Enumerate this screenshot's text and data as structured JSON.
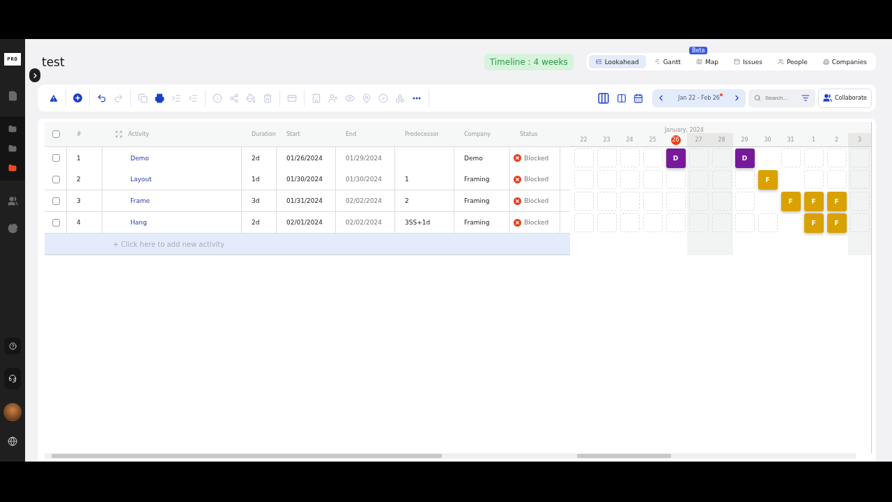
{
  "sidebar": {
    "logo": "PRO",
    "items": [
      {
        "kind": "file",
        "selected": false
      },
      {
        "kind": "folder",
        "selected": false
      },
      {
        "kind": "folder",
        "selected": false
      },
      {
        "kind": "folder",
        "selected": true
      },
      {
        "kind": "people",
        "selected": false
      },
      {
        "kind": "chart",
        "selected": false
      }
    ],
    "bottom": [
      {
        "kind": "help"
      },
      {
        "kind": "headset"
      },
      {
        "kind": "avatar"
      },
      {
        "kind": "globe"
      }
    ]
  },
  "page": {
    "title": "test",
    "timeline": "Timeline : 4 weeks"
  },
  "nav_tabs": [
    {
      "label": "Lookahead",
      "kind": "lookahead",
      "selected": true
    },
    {
      "label": "Gantt",
      "kind": "gantt",
      "selected": false
    },
    {
      "label": "Map",
      "kind": "map",
      "selected": false,
      "badge": "Beta"
    },
    {
      "label": "Issues",
      "kind": "issues",
      "selected": false
    },
    {
      "label": "People",
      "kind": "people",
      "selected": false
    },
    {
      "label": "Companies",
      "kind": "companies",
      "selected": false
    }
  ],
  "toolbar": {
    "groups": [
      [
        {
          "kind": "warning",
          "disabled": false
        }
      ],
      [
        {
          "kind": "add",
          "disabled": false
        }
      ],
      [
        {
          "kind": "undo",
          "disabled": false
        },
        {
          "kind": "redo",
          "disabled": true
        }
      ],
      [
        {
          "kind": "copy",
          "disabled": true
        },
        {
          "kind": "print",
          "disabled": false
        },
        {
          "kind": "indent",
          "disabled": true
        },
        {
          "kind": "outdent",
          "disabled": true
        }
      ],
      [
        {
          "kind": "info",
          "disabled": true
        },
        {
          "kind": "share",
          "disabled": true
        },
        {
          "kind": "paint",
          "disabled": true
        },
        {
          "kind": "delete",
          "disabled": true
        }
      ],
      [
        {
          "kind": "card",
          "disabled": true
        }
      ],
      [
        {
          "kind": "building",
          "disabled": true
        },
        {
          "kind": "user-add",
          "disabled": true
        },
        {
          "kind": "eye",
          "disabled": true
        },
        {
          "kind": "pin",
          "disabled": true
        },
        {
          "kind": "check",
          "disabled": true
        },
        {
          "kind": "shapes",
          "disabled": true
        },
        {
          "kind": "more",
          "disabled": false
        }
      ]
    ],
    "views": [
      {
        "kind": "columns3"
      },
      {
        "kind": "columns2"
      },
      {
        "kind": "calendar"
      }
    ],
    "date_range": "Jan 22 - Feb 26",
    "search": {
      "placeholder": "Search..."
    },
    "collaborate": "Collaborate"
  },
  "table": {
    "select_all_checked": false,
    "columns": [
      "#",
      "Activity",
      "Duration",
      "Start",
      "End",
      "Predecessor",
      "Company",
      "Status"
    ],
    "rows": [
      {
        "checked": false,
        "cells": [
          "1",
          "Demo",
          "2d",
          "01/26/2024",
          "01/29/2024",
          "",
          "Demo",
          "Blocked"
        ]
      },
      {
        "checked": false,
        "cells": [
          "2",
          "Layout",
          "1d",
          "01/30/2024",
          "01/30/2024",
          "1",
          "Framing",
          "Blocked"
        ]
      },
      {
        "checked": false,
        "cells": [
          "3",
          "Frame",
          "3d",
          "01/31/2024",
          "02/02/2024",
          "2",
          "Framing",
          "Blocked"
        ]
      },
      {
        "checked": false,
        "cells": [
          "4",
          "Hang",
          "2d",
          "02/01/2024",
          "02/02/2024",
          "3SS+1d",
          "Framing",
          "Blocked"
        ]
      }
    ],
    "add_row": "+ Click here to add new activity"
  },
  "gantt": {
    "month": "January, 2024",
    "days": [
      {
        "label": "22",
        "weekend": false,
        "today": false
      },
      {
        "label": "23",
        "weekend": false,
        "today": false
      },
      {
        "label": "24",
        "weekend": false,
        "today": false
      },
      {
        "label": "25",
        "weekend": false,
        "today": false
      },
      {
        "label": "26",
        "weekend": false,
        "today": true
      },
      {
        "label": "27",
        "weekend": true,
        "today": false
      },
      {
        "label": "28",
        "weekend": true,
        "today": false
      },
      {
        "label": "29",
        "weekend": false,
        "today": false
      },
      {
        "label": "30",
        "weekend": false,
        "today": false
      },
      {
        "label": "31",
        "weekend": false,
        "today": false
      },
      {
        "label": "1",
        "weekend": false,
        "today": false
      },
      {
        "label": "2",
        "weekend": false,
        "today": false
      },
      {
        "label": "3",
        "weekend": true,
        "today": false
      }
    ],
    "rows": [
      {
        "cells": [
          {
            "kind": "empty"
          },
          {
            "kind": "empty"
          },
          {
            "kind": "empty"
          },
          {
            "kind": "empty"
          },
          {
            "kind": "bar",
            "letter": "D",
            "color": "#761a9a"
          },
          {
            "kind": "empty"
          },
          {
            "kind": "empty"
          },
          {
            "kind": "bar",
            "letter": "D",
            "color": "#761a9a"
          },
          {
            "kind": "blank"
          },
          {
            "kind": "empty"
          },
          {
            "kind": "empty"
          },
          {
            "kind": "empty"
          },
          {
            "kind": "empty"
          }
        ]
      },
      {
        "cells": [
          {
            "kind": "empty"
          },
          {
            "kind": "empty"
          },
          {
            "kind": "empty"
          },
          {
            "kind": "empty"
          },
          {
            "kind": "empty"
          },
          {
            "kind": "empty"
          },
          {
            "kind": "empty"
          },
          {
            "kind": "empty"
          },
          {
            "kind": "bar",
            "letter": "F",
            "color": "#d9a200"
          },
          {
            "kind": "blank"
          },
          {
            "kind": "empty"
          },
          {
            "kind": "empty"
          },
          {
            "kind": "empty"
          }
        ]
      },
      {
        "cells": [
          {
            "kind": "empty"
          },
          {
            "kind": "empty"
          },
          {
            "kind": "empty"
          },
          {
            "kind": "empty"
          },
          {
            "kind": "empty"
          },
          {
            "kind": "empty"
          },
          {
            "kind": "empty"
          },
          {
            "kind": "empty"
          },
          {
            "kind": "blank"
          },
          {
            "kind": "bar",
            "letter": "F",
            "color": "#d9a200"
          },
          {
            "kind": "bar",
            "letter": "F",
            "color": "#d9a200"
          },
          {
            "kind": "bar",
            "letter": "F",
            "color": "#d9a200"
          },
          {
            "kind": "empty"
          }
        ]
      },
      {
        "cells": [
          {
            "kind": "empty"
          },
          {
            "kind": "empty"
          },
          {
            "kind": "empty"
          },
          {
            "kind": "empty"
          },
          {
            "kind": "empty"
          },
          {
            "kind": "empty"
          },
          {
            "kind": "empty"
          },
          {
            "kind": "empty"
          },
          {
            "kind": "empty"
          },
          {
            "kind": "blank"
          },
          {
            "kind": "bar",
            "letter": "F",
            "color": "#d9a200"
          },
          {
            "kind": "bar",
            "letter": "F",
            "color": "#d9a200"
          },
          {
            "kind": "empty"
          }
        ]
      }
    ]
  }
}
